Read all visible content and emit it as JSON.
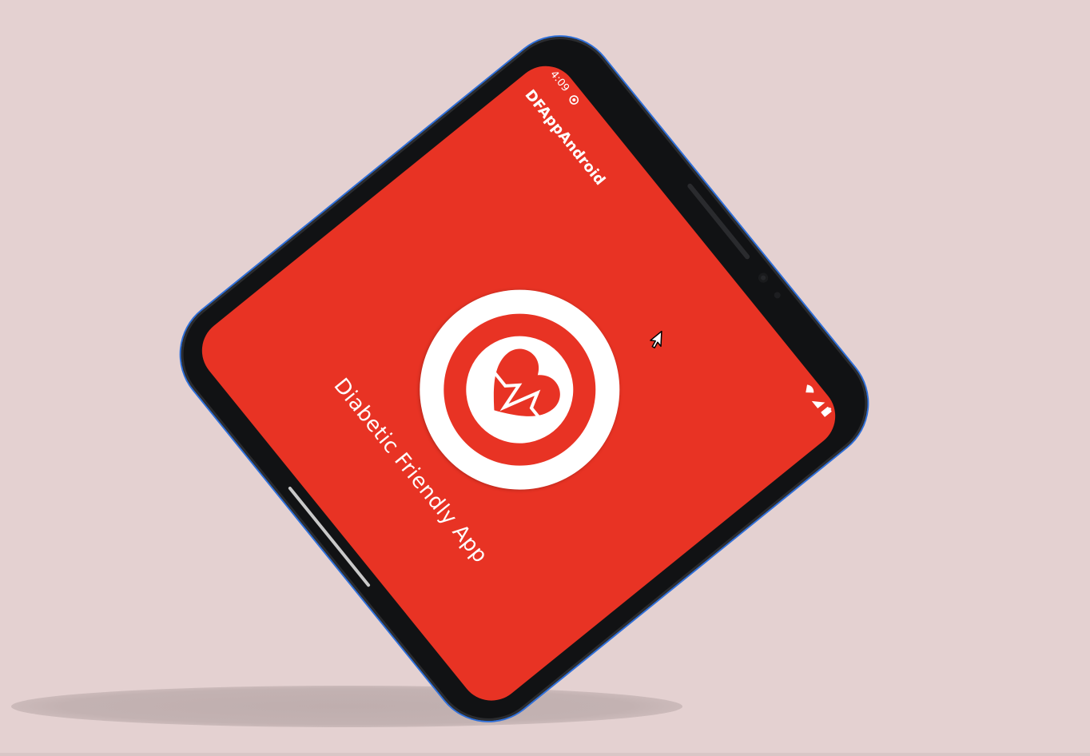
{
  "status_bar": {
    "time": "4:09",
    "notification_icon": "android-debug-icon",
    "wifi_icon": "wifi-icon",
    "signal_icon": "signal-icon",
    "battery_icon": "battery-icon"
  },
  "app_bar": {
    "title": "DFAppAndroid"
  },
  "splash": {
    "app_name": "Diabetic Friendly App",
    "logo_icon": "heart-pulse-icon"
  },
  "colors": {
    "background": "#e4d1d1",
    "brand_red": "#e83324",
    "white": "#ffffff",
    "phone_frame": "#111214",
    "frame_outline": "#2f6fd8"
  }
}
